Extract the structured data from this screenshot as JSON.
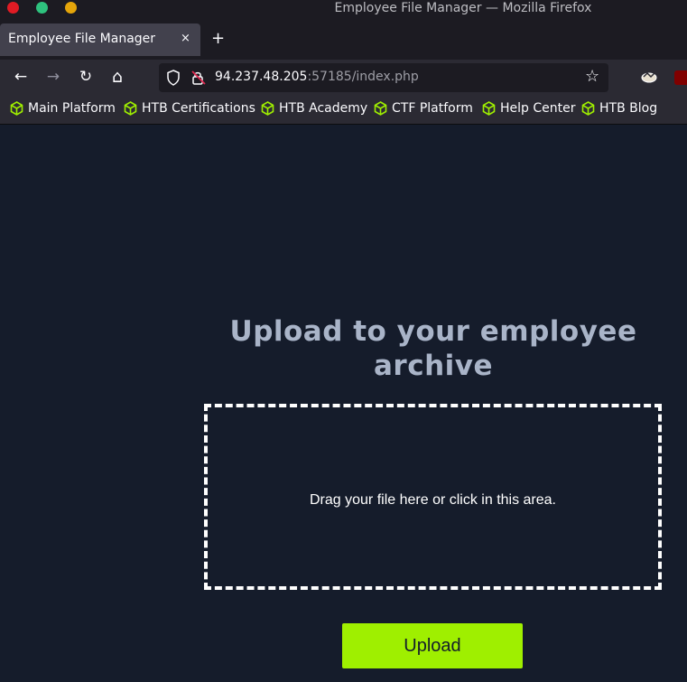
{
  "window": {
    "title": "Employee File Manager — Mozilla Firefox"
  },
  "tab": {
    "label": "Employee File Manager",
    "close": "×",
    "new_tab": "+"
  },
  "nav": {
    "back": "←",
    "forward": "→",
    "reload": "↻",
    "home": "⌂",
    "url_host": "94.237.48.205",
    "url_rest": ":57185/index.php",
    "bookmark_star": "☆"
  },
  "bookmarks": [
    {
      "label": "Main Platform"
    },
    {
      "label": "HTB Certifications"
    },
    {
      "label": "HTB Academy"
    },
    {
      "label": "CTF Platform"
    },
    {
      "label": "Help Center"
    },
    {
      "label": "HTB Blog"
    }
  ],
  "page": {
    "heading": "Upload to your employee archive",
    "dropzone_text": "Drag your file here or click in this area.",
    "upload_label": "Upload"
  },
  "colors": {
    "page_bg": "#151c2b",
    "accent": "#9fef00",
    "heading": "#a9b4c8"
  }
}
